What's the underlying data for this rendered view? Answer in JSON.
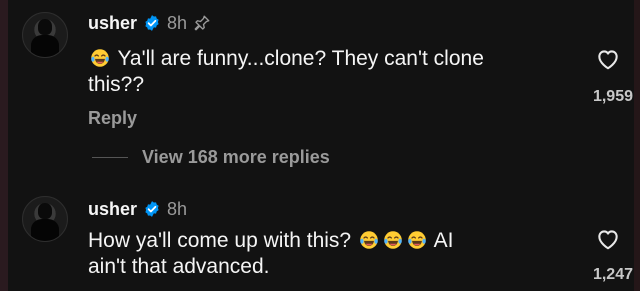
{
  "comments": [
    {
      "username": "usher",
      "time": "8h",
      "pinned": true,
      "text_before": "Ya'll are funny...clone?  They can't clone",
      "text_line2": "this??",
      "reply_label": "Reply",
      "likes": "1,959"
    },
    {
      "username": "usher",
      "time": "8h",
      "pinned": false,
      "text_before": "How ya'll come up with this?",
      "text_after": "AI",
      "text_line2": "ain't that advanced.",
      "likes": "1,247"
    }
  ],
  "replies": {
    "view_more_label": "View 168 more replies"
  },
  "icons": {
    "verified": "verified-badge-icon",
    "pin": "pin-icon",
    "like": "heart-outline-icon",
    "emoji": "laughing-tears-emoji"
  },
  "colors": {
    "background": "#121212",
    "text": "#f5f5f5",
    "muted": "#9a9a9a",
    "verified": "#0095f6"
  }
}
